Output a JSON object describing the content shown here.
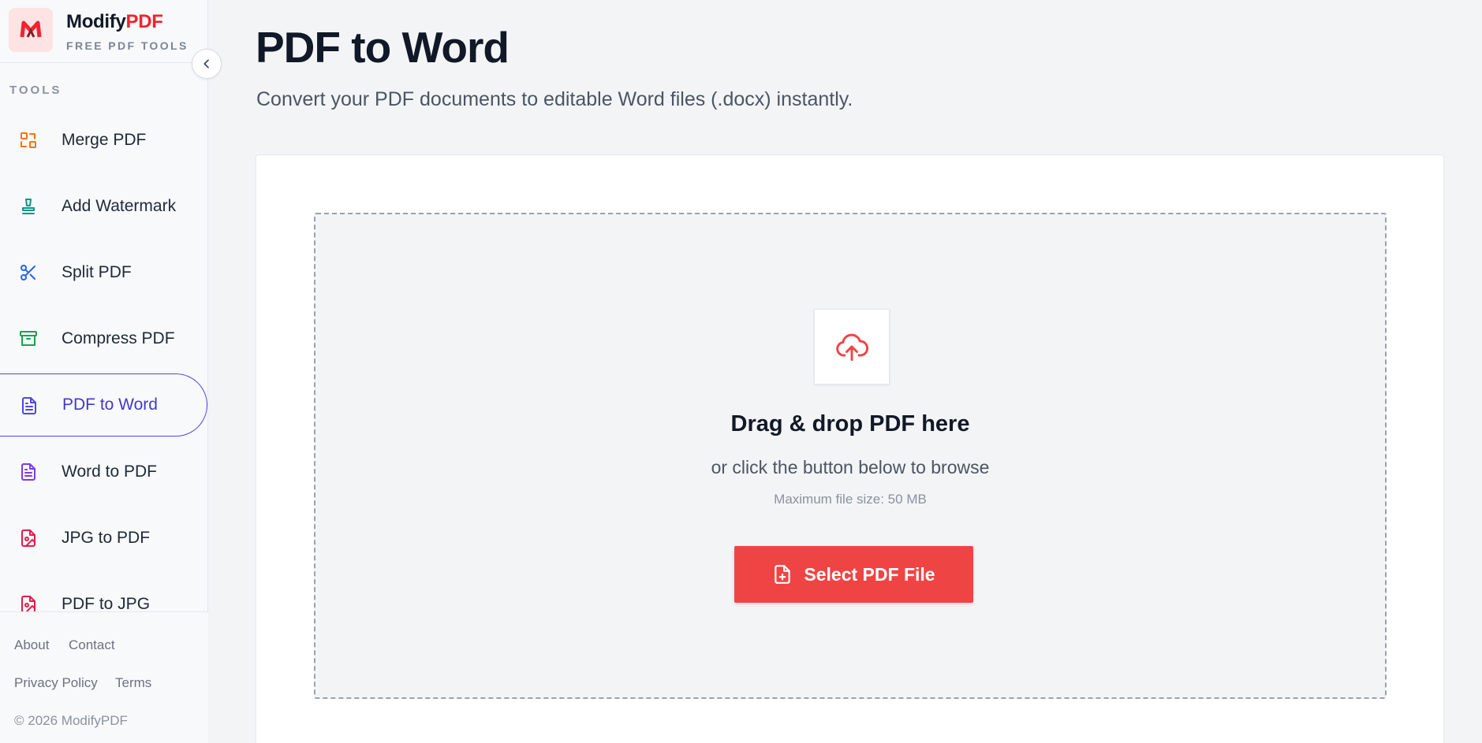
{
  "brand": {
    "name_main": "Modify",
    "name_accent": "PDF",
    "tagline": "FREE PDF TOOLS",
    "logo_icon": "modifypdf-logo-icon",
    "accent_color": "#ee2430"
  },
  "sidebar": {
    "collapse_icon": "chevron-left-icon",
    "section_heading": "TOOLS",
    "items": [
      {
        "label": "Merge PDF",
        "icon": "merge-icon",
        "color": "#f97316"
      },
      {
        "label": "Add Watermark",
        "icon": "stamp-icon",
        "color": "#0d9488"
      },
      {
        "label": "Split PDF",
        "icon": "scissors-icon",
        "color": "#2563eb"
      },
      {
        "label": "Compress PDF",
        "icon": "archive-icon",
        "color": "#16a34a"
      },
      {
        "label": "PDF to Word",
        "icon": "document-icon",
        "color": "#4f46e5",
        "active": true
      },
      {
        "label": "Word to PDF",
        "icon": "document-icon",
        "color": "#7c3aed"
      },
      {
        "label": "JPG to PDF",
        "icon": "image-file-icon",
        "color": "#e11d48"
      },
      {
        "label": "PDF to JPG",
        "icon": "image-file-icon",
        "color": "#e11d48"
      }
    ],
    "footer": {
      "about": "About",
      "contact": "Contact",
      "privacy": "Privacy Policy",
      "terms": "Terms",
      "copyright": "© 2026 ModifyPDF"
    }
  },
  "main": {
    "title": "PDF to Word",
    "subtitle": "Convert your PDF documents to editable Word files (.docx) instantly.",
    "dropzone": {
      "icon": "cloud-upload-icon",
      "title": "Drag & drop PDF here",
      "subtitle": "or click the button below to browse",
      "max_size": "Maximum file size: 50 MB",
      "button_label": "Select PDF File",
      "button_icon": "file-plus-icon",
      "button_color": "#ef4444"
    }
  }
}
